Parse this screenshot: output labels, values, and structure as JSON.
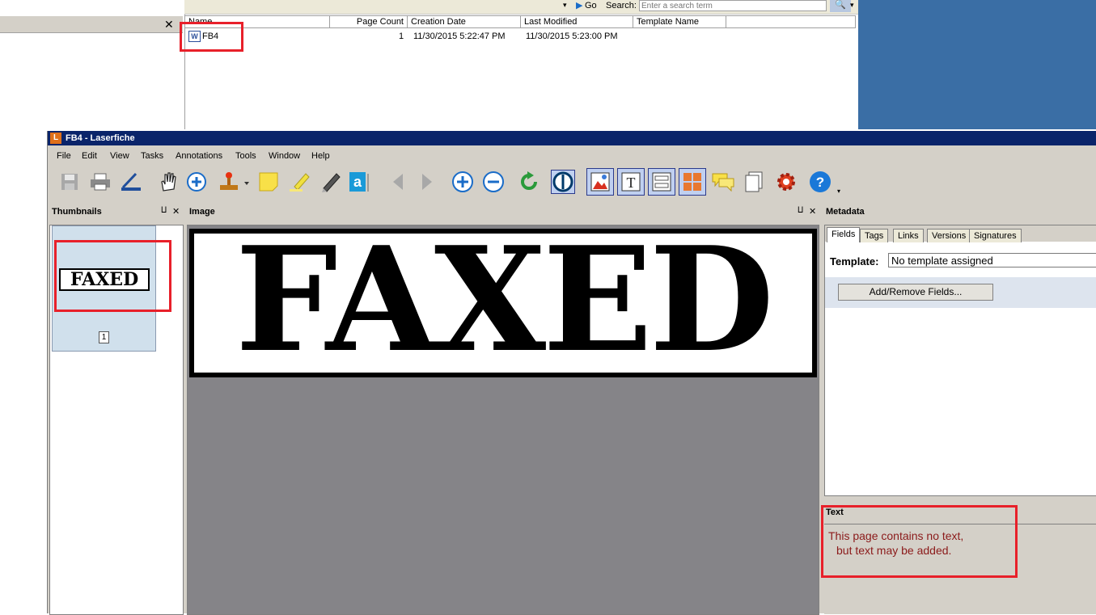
{
  "browser": {
    "go_label": "Go",
    "search_label": "Search:",
    "search_placeholder": "Enter a search term",
    "columns": [
      "Name",
      "Page Count",
      "Creation Date",
      "Last Modified",
      "Template Name"
    ],
    "rows": [
      {
        "name": "FB4",
        "page_count": "1",
        "created": "11/30/2015 5:22:47 PM",
        "modified": "11/30/2015 5:23:00 PM",
        "template": ""
      }
    ]
  },
  "window": {
    "app_icon_letter": "L",
    "title": "FB4 - Laserfiche",
    "menus": [
      "File",
      "Edit",
      "View",
      "Tasks",
      "Annotations",
      "Tools",
      "Window",
      "Help"
    ]
  },
  "panes": {
    "thumbnails": "Thumbnails",
    "image": "Image",
    "metadata": "Metadata",
    "text": "Text",
    "pin_glyph": "⨿",
    "close_glyph": "✕"
  },
  "thumbnail": {
    "page_number": "1",
    "stamp_text": "FAXED"
  },
  "image_stamp": "FAXED",
  "metadata": {
    "tabs": [
      "Fields",
      "Tags",
      "Links",
      "Versions",
      "Signatures"
    ],
    "template_label": "Template:",
    "template_value": "No template assigned",
    "add_remove_button": "Add/Remove Fields..."
  },
  "text_pane": {
    "line1": "This page contains no text,",
    "line2": "but text may be added."
  },
  "colors": {
    "title_bar": "#0a246a",
    "highlight_red": "#e8202a",
    "desktop_blue": "#3a6ea5",
    "image_bg": "#858488",
    "text_message": "#8b1a1a"
  }
}
